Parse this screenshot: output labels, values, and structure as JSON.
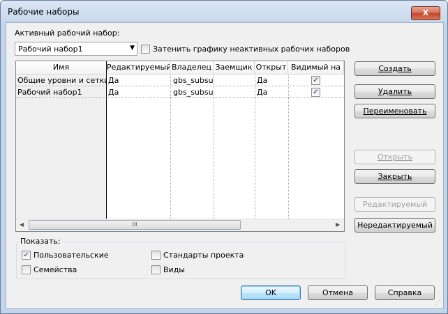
{
  "window": {
    "title": "Рабочие наборы",
    "close_label": "X"
  },
  "active": {
    "label": "Активный рабочий набор:",
    "selected": "Рабочий набор1",
    "dim_label": "Затенить графику неактивных рабочих наборов",
    "dim_checked": false
  },
  "grid": {
    "columns": [
      "Имя",
      "Редактируемый",
      "Владелец",
      "Заемщик",
      "Открыт",
      "Видимый на"
    ],
    "rows": [
      {
        "name": "Общие уровни и сетки",
        "editable": "Да",
        "owner": "gbs_subsu",
        "borrower": "",
        "open": "Да",
        "visible": true
      },
      {
        "name": "Рабочий набор1",
        "editable": "Да",
        "owner": "gbs_subsu",
        "borrower": "",
        "open": "Да",
        "visible": true
      }
    ],
    "scroll_left": "◀",
    "scroll_right": "▶",
    "scroll_grip": "III"
  },
  "buttons": {
    "create": "Создать",
    "delete": "Удалить",
    "rename": "Переименовать",
    "open": "Открыть",
    "close": "Закрыть",
    "editable": "Редактируемый",
    "noneditable": "Нередактируемый",
    "ok": "OK",
    "cancel": "Отмена",
    "help": "Справка"
  },
  "show": {
    "label": "Показать:",
    "user": "Пользовательские",
    "user_checked": true,
    "families": "Семейства",
    "families_checked": false,
    "standards": "Стандарты проекта",
    "standards_checked": false,
    "views": "Виды",
    "views_checked": false
  }
}
